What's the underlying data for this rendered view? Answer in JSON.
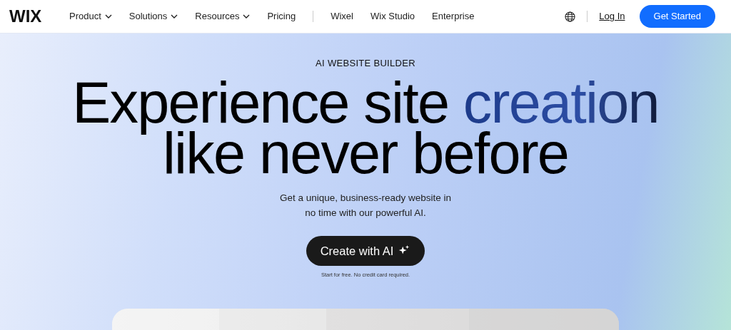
{
  "header": {
    "logo": "WIX",
    "nav": [
      {
        "label": "Product",
        "dropdown": true
      },
      {
        "label": "Solutions",
        "dropdown": true
      },
      {
        "label": "Resources",
        "dropdown": true
      },
      {
        "label": "Pricing",
        "dropdown": false
      }
    ],
    "nav_secondary": [
      {
        "label": "Wixel"
      },
      {
        "label": "Wix Studio"
      },
      {
        "label": "Enterprise"
      }
    ],
    "login": "Log In",
    "cta": "Get Started"
  },
  "hero": {
    "eyebrow": "AI WEBSITE BUILDER",
    "headline": [
      [
        {
          "text": "Experience site ",
          "highlight": false
        },
        {
          "text": "creation",
          "highlight": true
        }
      ],
      [
        {
          "text": "like never before",
          "highlight": false
        }
      ]
    ],
    "subtitle": "Get a unique, business-ready website in no time with our powerful AI.",
    "button": "Create with AI",
    "note": "Start for free. No credit card required.",
    "preview": {
      "kind": "picture"
    }
  }
}
